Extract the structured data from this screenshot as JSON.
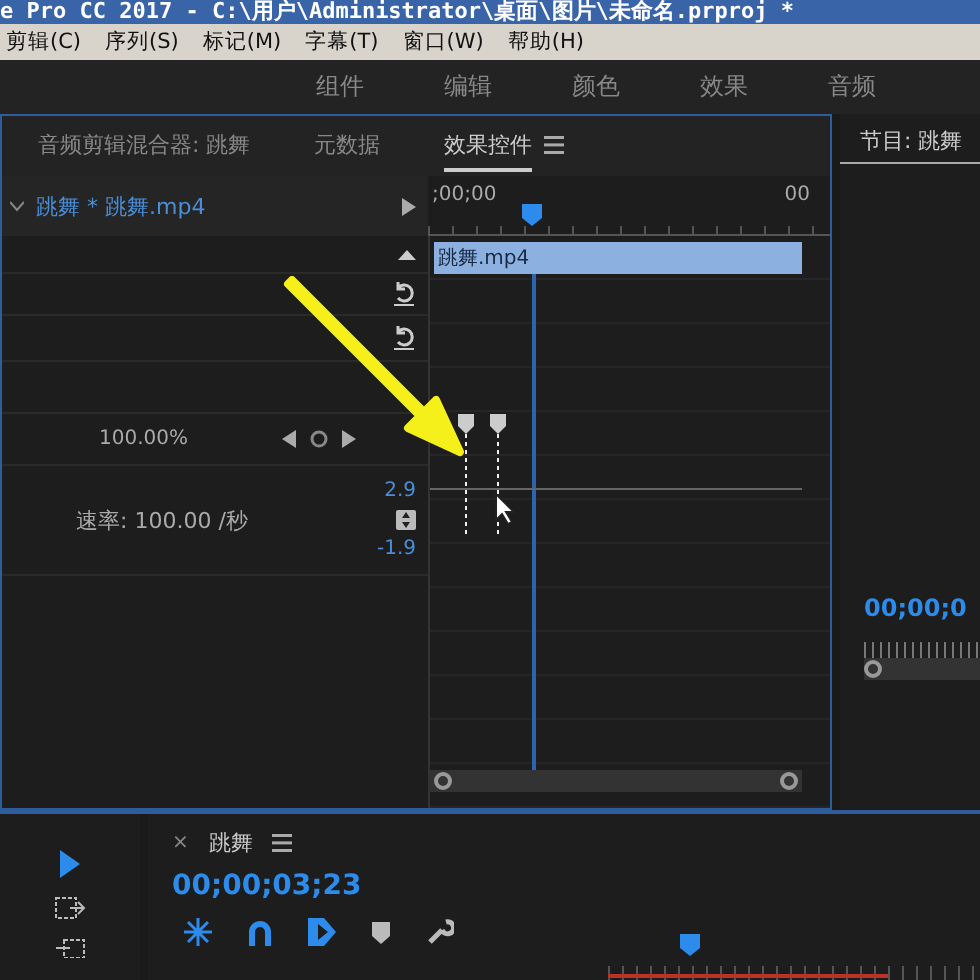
{
  "title_bar": {
    "title": "e Pro CC 2017 - C:\\用户\\Administrator\\桌面\\图片\\未命名.prproj *"
  },
  "menu": [
    "剪辑(C)",
    "序列(S)",
    "标记(M)",
    "字幕(T)",
    "窗口(W)",
    "帮助(H)"
  ],
  "workspaces": [
    {
      "label": "组件",
      "selected": false
    },
    {
      "label": "编辑",
      "selected": false
    },
    {
      "label": "颜色",
      "selected": false
    },
    {
      "label": "效果",
      "selected": false
    },
    {
      "label": "音频",
      "selected": false
    }
  ],
  "effect_panel": {
    "tabs": [
      {
        "label": "音频剪辑混合器: 跳舞",
        "selected": false
      },
      {
        "label": "元数据",
        "selected": false
      },
      {
        "label": "效果控件",
        "selected": true
      }
    ],
    "clip_path": "跳舞 * 跳舞.mp4",
    "ruler_start": ";00;00",
    "ruler_end": "00",
    "clip_label": "跳舞.mp4",
    "value": "100.00%",
    "graph_max": "2.9",
    "speed": "速率: 100.00 /秒",
    "graph_min": "-1.9"
  },
  "program_panel": {
    "title": "节目: 跳舞",
    "timecode": "00;00;0"
  },
  "timeline_panel": {
    "close": "×",
    "title": "跳舞",
    "timecode": "00;00;03;23"
  }
}
